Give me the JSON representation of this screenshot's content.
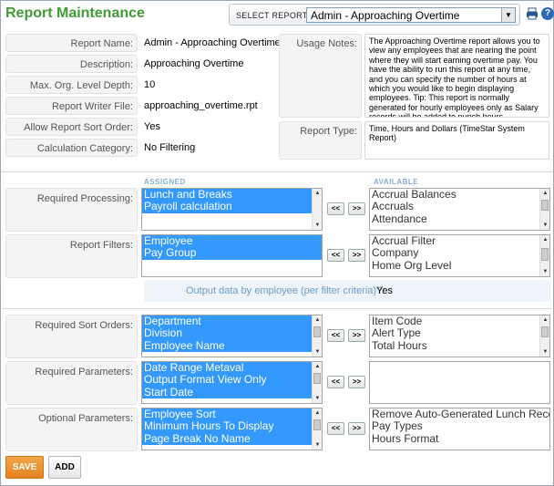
{
  "header": {
    "title": "Report Maintenance",
    "select_label": "SELECT REPORT:",
    "select_value": "Admin - Approaching Overtime",
    "print_icon": "printer-icon",
    "help_icon": "help-icon",
    "help_glyph": "?"
  },
  "fields": {
    "report_name": {
      "label": "Report Name:",
      "value": "Admin - Approaching Overtime"
    },
    "description": {
      "label": "Description:",
      "value": "Approaching Overtime"
    },
    "max_org_depth": {
      "label": "Max. Org. Level Depth:",
      "value": "10"
    },
    "writer_file": {
      "label": "Report Writer File:",
      "value": "approaching_overtime.rpt"
    },
    "allow_sort": {
      "label": "Allow Report Sort Order:",
      "value": "Yes"
    },
    "calc_category": {
      "label": "Calculation Category:",
      "value": "No Filtering"
    },
    "usage_notes": {
      "label": "Usage Notes:",
      "value": "The Approaching Overtime report allows you to view any employees that are nearing the point where they will start earning overtime pay. You have the ability to run this report at any time, and you can specify the number of hours at which you would like to begin displaying employees. Tip: This report is normally generated for hourly employees only as Salary records will be added to punch hours."
    },
    "report_type": {
      "label": "Report Type:",
      "value": "Time, Hours and Dollars (TimeStar System Report)"
    }
  },
  "columns": {
    "assigned": "ASSIGNED",
    "available": "AVAILABLE"
  },
  "buttons": {
    "add_arrow": "<<",
    "remove_arrow": ">>",
    "save": "SAVE",
    "add": "ADD"
  },
  "sections": {
    "required_processing": {
      "label": "Required Processing:",
      "assigned": [
        "Lunch and Breaks",
        "Payroll calculation"
      ],
      "available": [
        "Accrual Balances",
        "Accruals",
        "Attendance"
      ]
    },
    "report_filters": {
      "label": "Report Filters:",
      "assigned": [
        "Employee",
        "Pay Group"
      ],
      "available": [
        "Accrual Filter",
        "Company",
        "Home Org Level"
      ]
    },
    "required_sort_orders": {
      "label": "Required Sort Orders:",
      "assigned": [
        "Department",
        "Division",
        "Employee Name"
      ],
      "available": [
        "Item Code",
        "Alert Type",
        "Total Hours"
      ]
    },
    "required_parameters": {
      "label": "Required Parameters:",
      "assigned": [
        "Date Range Metaval",
        "Output Format View Only",
        "Start Date"
      ],
      "available": []
    },
    "optional_parameters": {
      "label": "Optional Parameters:",
      "assigned": [
        "Employee Sort",
        "Minimum Hours To Display",
        "Page Break No Name"
      ],
      "available": [
        "Remove Auto-Generated Lunch Records",
        "Pay Types",
        "Hours Format"
      ]
    }
  },
  "filter_note": {
    "label": "Output data by employee (per filter criteria)?:",
    "value": "Yes"
  }
}
